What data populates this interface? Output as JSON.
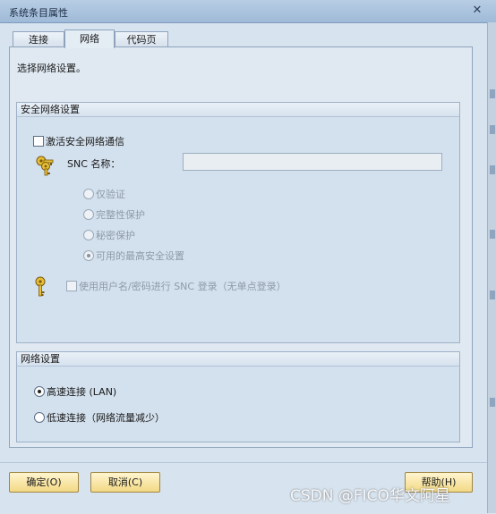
{
  "window": {
    "title": "系统条目属性",
    "close": "✕"
  },
  "tabs": [
    {
      "label": "连接",
      "active": false
    },
    {
      "label": "网络",
      "active": true
    },
    {
      "label": "代码页",
      "active": false
    }
  ],
  "prompt": "选择网络设置。",
  "security_group": {
    "title": "安全网络设置",
    "enable_label": "激活安全网络通信",
    "enable_checked": false,
    "snc_name_label": "SNC 名称：",
    "snc_name_value": "",
    "protection_options": [
      {
        "label": "仅验证",
        "selected": false
      },
      {
        "label": "完整性保护",
        "selected": false
      },
      {
        "label": "秘密保护",
        "selected": false
      },
      {
        "label": "可用的最高安全设置",
        "selected": true
      }
    ],
    "user_login_label": "使用用户名/密码进行 SNC 登录（无单点登录）",
    "user_login_checked": false
  },
  "network_group": {
    "title": "网络设置",
    "options": [
      {
        "label": "高速连接 (LAN)",
        "selected": true
      },
      {
        "label": "低速连接（网络流量减少）",
        "selected": false
      }
    ]
  },
  "buttons": {
    "ok": "确定(O)",
    "cancel": "取消(C)",
    "help": "帮助(H)"
  },
  "watermark": "CSDN @FICO华文阿星"
}
